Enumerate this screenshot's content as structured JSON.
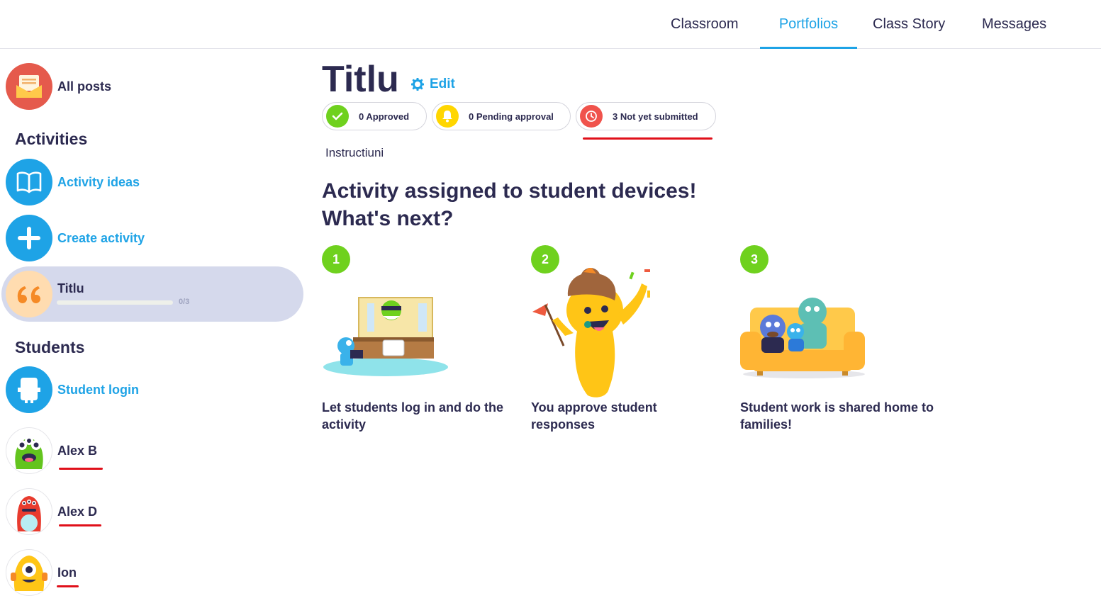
{
  "nav": {
    "tabs": [
      {
        "label": "Classroom",
        "active": false
      },
      {
        "label": "Portfolios",
        "active": true
      },
      {
        "label": "Class Story",
        "active": false
      },
      {
        "label": "Messages",
        "active": false
      }
    ]
  },
  "sidebar": {
    "all_posts": "All posts",
    "activities_heading": "Activities",
    "activity_ideas": "Activity ideas",
    "create_activity": "Create activity",
    "selected_activity": {
      "name": "Titlu",
      "progress_text": "0/3",
      "progress": 0
    },
    "students_heading": "Students",
    "student_login": "Student login",
    "students": [
      "Alex B",
      "Alex D",
      "Ion"
    ]
  },
  "main": {
    "title": "Titlu",
    "edit_label": "Edit",
    "status": {
      "approved": "0 Approved",
      "pending": "0 Pending approval",
      "not_submitted": "3 Not yet submitted"
    },
    "instructions": "Instructiuni",
    "headline_line1": "Activity assigned to student devices!",
    "headline_line2": "What's next?",
    "steps": [
      {
        "number": "1",
        "text": "Let students log in and do the activity"
      },
      {
        "number": "2",
        "text": "You approve student responses"
      },
      {
        "number": "3",
        "text": "Student work is shared home to families!"
      }
    ]
  },
  "colors": {
    "accent_blue": "#1ea3e6",
    "text_navy": "#2c2a50",
    "step_green": "#6fd11e",
    "approved_green": "#6fd11e",
    "pending_yellow": "#ffd600",
    "not_submitted_red": "#f0534c",
    "selected_bg": "#d5d9ec",
    "annotation_red": "#e0101a"
  }
}
